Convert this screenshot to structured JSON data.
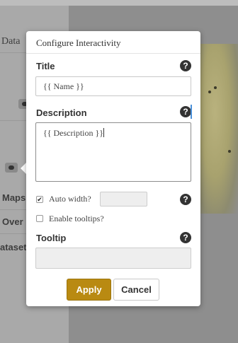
{
  "background": {
    "data_label": "Data",
    "maps_label": "Maps",
    "over_label": "Over",
    "dataset_label": "ataset"
  },
  "modal": {
    "title": "Configure Interactivity",
    "title_section": {
      "label": "Title",
      "value": "{{ Name }}"
    },
    "description_section": {
      "label": "Description",
      "value": "{{ Description }}"
    },
    "auto_width": {
      "label": "Auto width?",
      "checked": true,
      "value": ""
    },
    "enable_tooltips": {
      "label": "Enable tooltips?",
      "checked": false
    },
    "tooltip_section": {
      "label": "Tooltip",
      "value": ""
    },
    "help_glyph": "?",
    "buttons": {
      "apply": "Apply",
      "cancel": "Cancel"
    }
  },
  "colors": {
    "accent": "#b98a12",
    "overlay": "#9f9f9f",
    "help_icon": "#333333"
  },
  "icons": [
    "help-icon",
    "chat-icon",
    "checkmark-icon"
  ]
}
